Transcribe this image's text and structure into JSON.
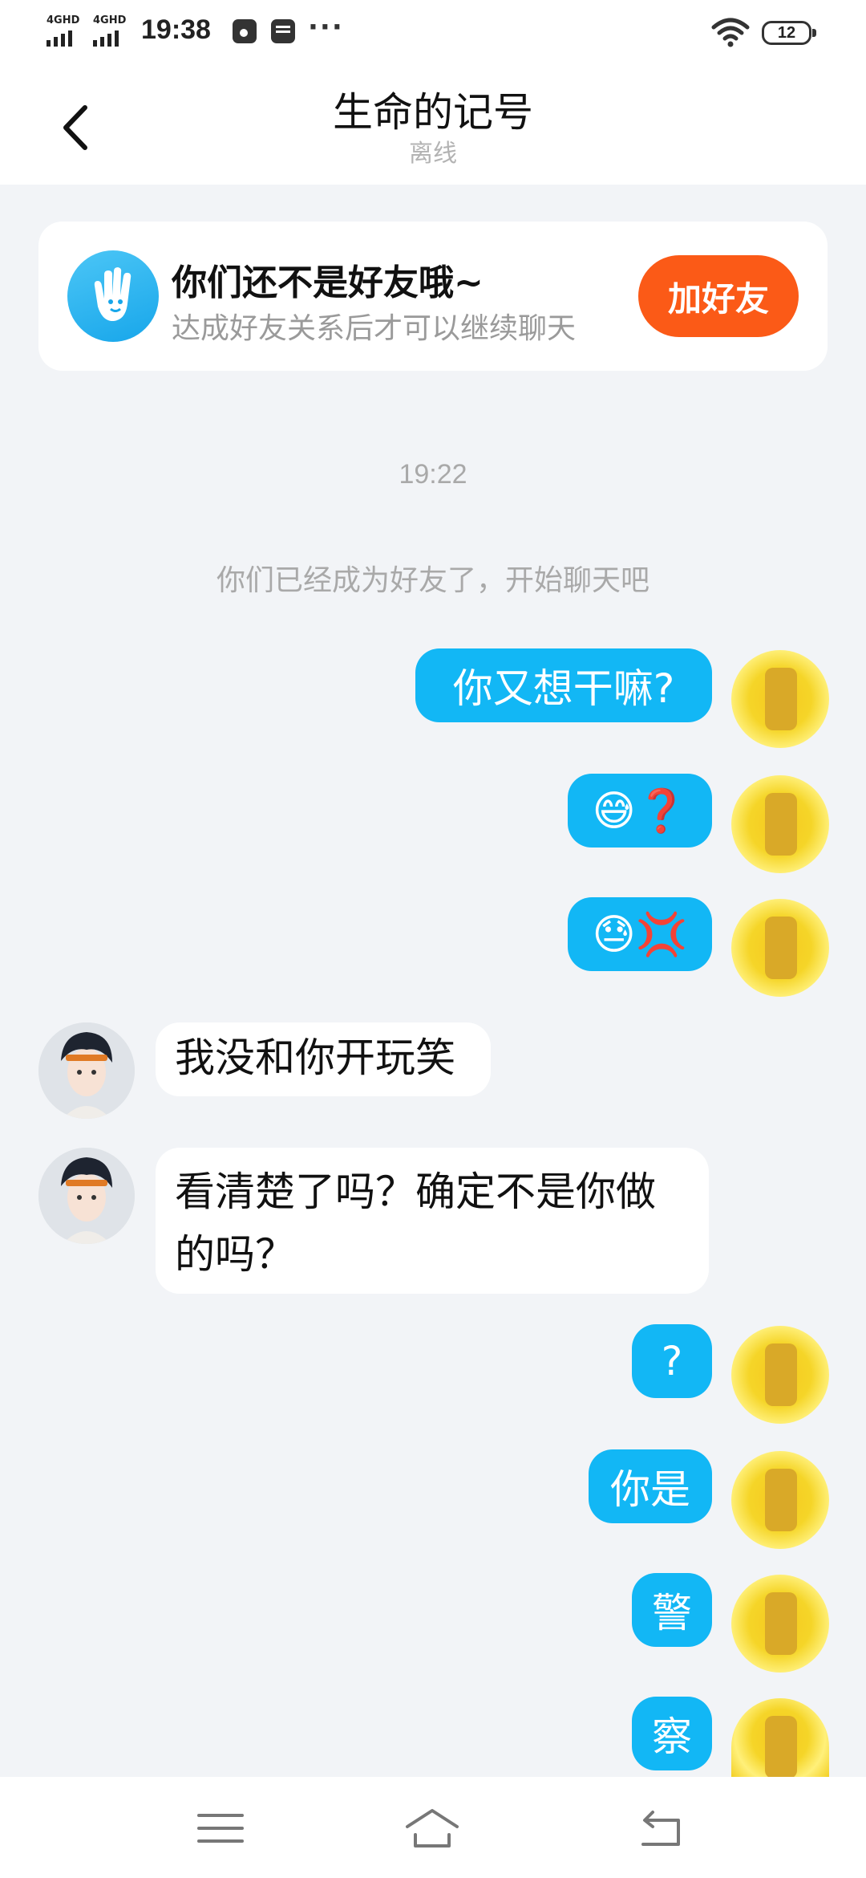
{
  "status_bar": {
    "network_1": "4GHD",
    "network_2": "4GHD",
    "time": "19:38",
    "more": "···",
    "battery": "12"
  },
  "header": {
    "title": "生命的记号",
    "subtitle": "离线"
  },
  "banner": {
    "title": "你们还不是好友哦~",
    "subtitle": "达成好友关系后才可以继续聊天",
    "add_button": "加好友"
  },
  "timestamp": "19:22",
  "system_message": "你们已经成为好友了，开始聊天吧",
  "messages": [
    {
      "side": "out",
      "text": "你又想干嘛?"
    },
    {
      "side": "out",
      "text": "😅❓"
    },
    {
      "side": "out",
      "text": "😓💢"
    },
    {
      "side": "in",
      "text": "我没和你开玩笑"
    },
    {
      "side": "in",
      "text": "看清楚了吗？确定不是你做的吗？"
    },
    {
      "side": "out",
      "text": "?"
    },
    {
      "side": "out",
      "text": "你是"
    },
    {
      "side": "out",
      "text": "警"
    },
    {
      "side": "out",
      "text": "察"
    }
  ],
  "colors": {
    "accent_blue": "#12b7f5",
    "add_friend_orange": "#fb5a17",
    "background": "#f2f4f7"
  },
  "icons": [
    "back-icon",
    "hand-wave-icon",
    "wifi-icon",
    "battery-icon",
    "menu-icon",
    "home-icon",
    "return-icon"
  ]
}
